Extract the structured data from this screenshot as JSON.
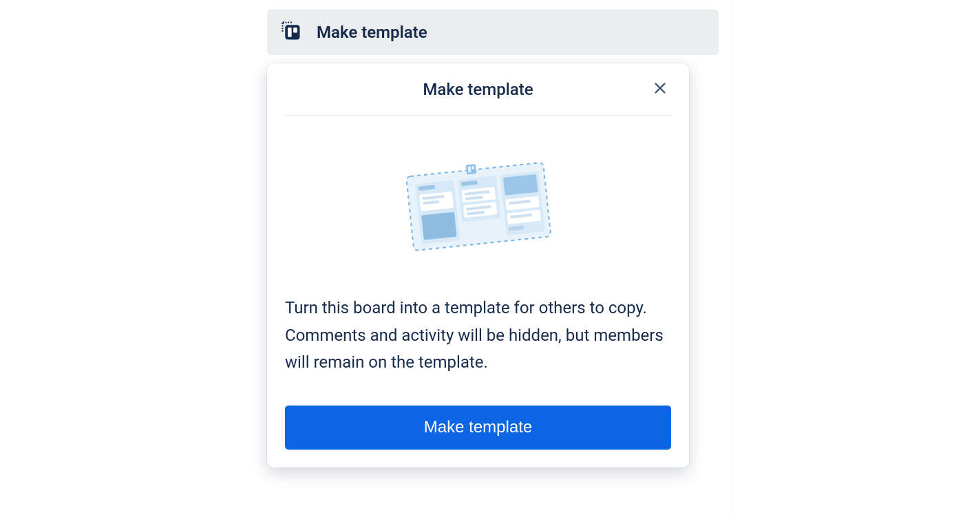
{
  "trigger": {
    "label": "Make template"
  },
  "popover": {
    "title": "Make template",
    "description": "Turn this board into a template for others to copy. Comments and activity will be hidden, but members will remain on the template.",
    "confirm_label": "Make template"
  },
  "colors": {
    "primary_button": "#0c66e4",
    "text": "#172b4d",
    "panel_bg": "#ecedee"
  }
}
